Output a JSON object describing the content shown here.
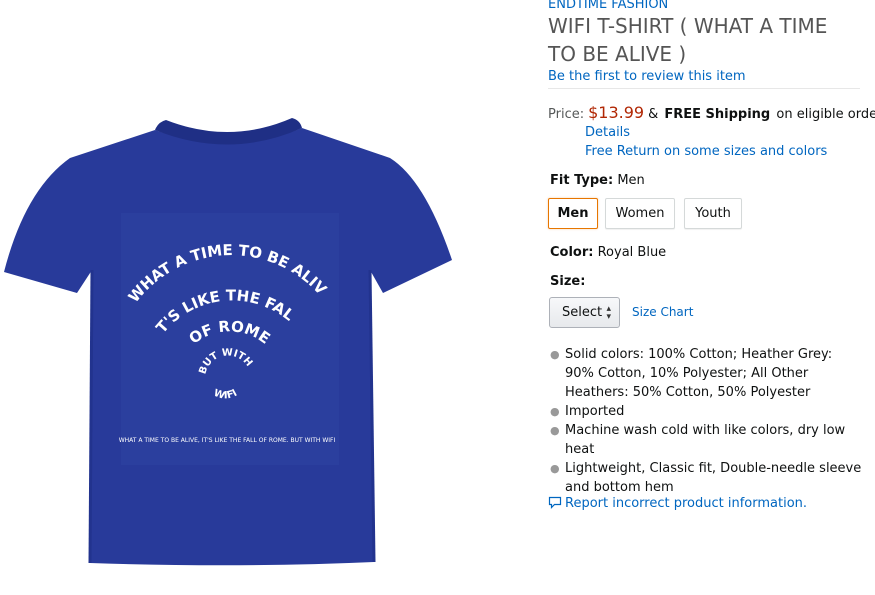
{
  "brand": "ENDTIME FASHION",
  "title": "WIFI T-SHIRT ( WHAT A TIME TO BE ALIVE )",
  "review_link": "Be the first to review this item",
  "price": {
    "label": "Price:",
    "value": "$13.99",
    "amp": "&",
    "free_shipping": "FREE Shipping",
    "shipping_rest": "on eligible orders.",
    "details_link": "Details",
    "return_link": "Free Return on some sizes and colors"
  },
  "fit": {
    "label": "Fit Type:",
    "value": "Men",
    "options": [
      "Men",
      "Women",
      "Youth"
    ],
    "selected": "Men"
  },
  "color": {
    "label": "Color:",
    "value": "Royal Blue"
  },
  "size": {
    "label": "Size:",
    "select_value": "Select",
    "chart_link": "Size Chart"
  },
  "bullets": [
    "Solid colors: 100% Cotton; Heather Grey: 90% Cotton, 10% Polyester; All Other Heathers: 50% Cotton, 50% Polyester",
    "Imported",
    "Machine wash cold with like colors, dry low heat",
    "Lightweight, Classic fit, Double-needle sleeve and bottom hem"
  ],
  "report_link": "Report incorrect product information.",
  "shirt_print": {
    "arc1": "WHAT A TIME TO BE ALIVE",
    "arc2": "IT'S LIKE THE FALL",
    "arc3": "OF ROME",
    "arc4a": "BUT WITH",
    "arc4b": "WIFI",
    "caption": "WHAT A TIME TO BE ALIVE, IT'S LIKE THE FALL OF ROME. BUT WITH WIFI"
  },
  "colors": {
    "shirt": "#283a9a",
    "link": "#0066c0",
    "price": "#b12704",
    "selected_border": "#e77600"
  }
}
